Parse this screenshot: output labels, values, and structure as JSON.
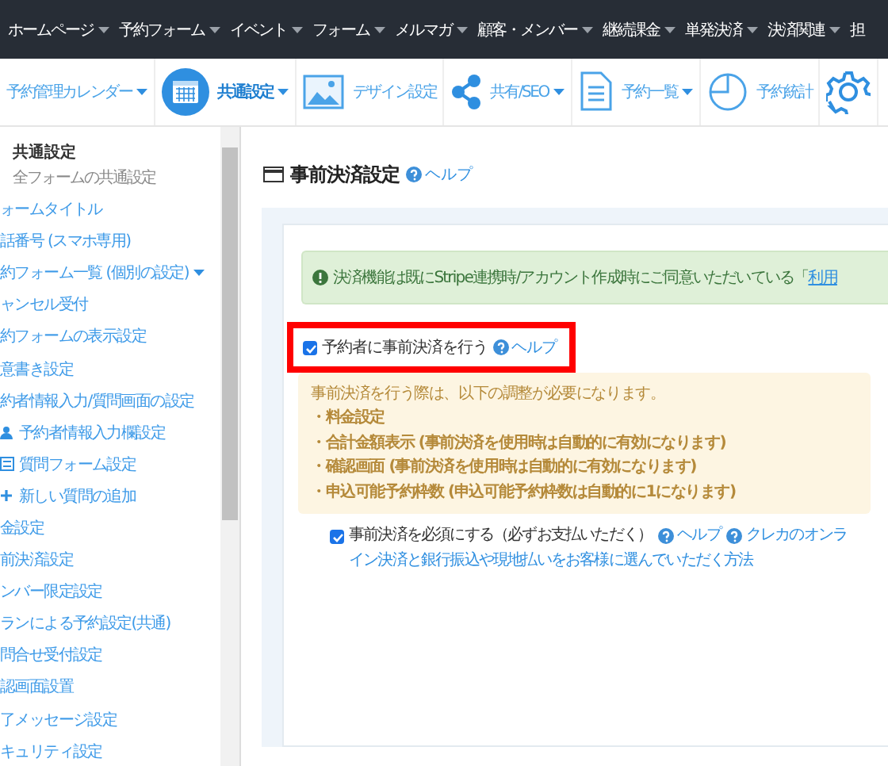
{
  "nav": {
    "items": [
      {
        "label": "ホームページ",
        "dropdown": true
      },
      {
        "label": "予約フォーム",
        "dropdown": true
      },
      {
        "label": "イベント",
        "dropdown": true
      },
      {
        "label": "フォーム",
        "dropdown": true
      },
      {
        "label": "メルマガ",
        "dropdown": true
      },
      {
        "label": "顧客・メンバー",
        "dropdown": true
      },
      {
        "label": "継続課金",
        "dropdown": true
      },
      {
        "label": "単発決済",
        "dropdown": true
      },
      {
        "label": "決済関連",
        "dropdown": true
      },
      {
        "label": "担",
        "dropdown": false
      }
    ]
  },
  "toolbar": {
    "items": [
      {
        "kind": "text",
        "label": "予約管理カレンダー",
        "dropdown": true,
        "selected": false
      },
      {
        "kind": "calendar",
        "label": "共通設定",
        "dropdown": true,
        "selected": true
      },
      {
        "kind": "image",
        "label": "デザイン設定",
        "dropdown": false,
        "selected": false
      },
      {
        "kind": "share",
        "label": "共有/SEO",
        "dropdown": true,
        "selected": false
      },
      {
        "kind": "document",
        "label": "予約一覧",
        "dropdown": true,
        "selected": false
      },
      {
        "kind": "pie",
        "label": "予約統計",
        "dropdown": false,
        "selected": false
      },
      {
        "kind": "gear"
      }
    ]
  },
  "sidebar": {
    "title": "共通設定",
    "subtitle": "全フォームの共通設定",
    "items": [
      {
        "kind": "text",
        "label": "ォームタイトル"
      },
      {
        "kind": "text",
        "label": "話番号 (スマホ専用)"
      },
      {
        "kind": "text",
        "label": "約フォーム一覧 (個別の設定)",
        "dropdown": true
      },
      {
        "kind": "text",
        "label": "ャンセル受付"
      },
      {
        "kind": "text",
        "label": "約フォームの表示設定"
      },
      {
        "kind": "text",
        "label": "意書き設定"
      },
      {
        "kind": "text",
        "label": "約者情報入力/質問画面の設定"
      },
      {
        "kind": "user",
        "label": "予約者情報入力欄設定"
      },
      {
        "kind": "list",
        "label": "質問フォーム設定"
      },
      {
        "kind": "plus",
        "label": "新しい質問の追加"
      },
      {
        "kind": "text",
        "label": "金設定"
      },
      {
        "kind": "text",
        "label": "前決済設定"
      },
      {
        "kind": "text",
        "label": "ンバー限定設定"
      },
      {
        "kind": "text",
        "label": "ランによる予約設定(共通)"
      },
      {
        "kind": "text",
        "label": "問合せ受付設定"
      },
      {
        "kind": "text",
        "label": "認画面設置"
      },
      {
        "kind": "text",
        "label": "了メッセージ設定"
      },
      {
        "kind": "text",
        "label": "キュリティ設定"
      }
    ]
  },
  "content": {
    "heading": "事前決済設定",
    "heading_help": "ヘルプ",
    "notice": {
      "text": "決済機能は既にStripe連携時/アカウント作成時にご同意いただいている「",
      "link": "利用"
    },
    "prepay": {
      "label": "予約者に事前決済を行う",
      "checked": true,
      "help": "ヘルプ",
      "highlighted": true
    },
    "requirements": {
      "intro": "事前決済を行う際は、以下の調整が必要になります。",
      "items": [
        "・料金設定",
        "・合計金額表示 (事前決済を使用時は自動的に有効になります)",
        "・確認画面 (事前決済を使用時は自動的に有効になります)",
        "・申込可能予約枠数 (申込可能予約枠数は自動的に1になります)"
      ]
    },
    "required": {
      "label": "事前決済を必須にする（必ずお支払いただく）",
      "checked": true,
      "help": "ヘルプ",
      "link_lines": [
        "クレカのオンラ",
        "イン決済と銀行振込や現地払いをお客様に選んでいただく方法"
      ]
    }
  }
}
